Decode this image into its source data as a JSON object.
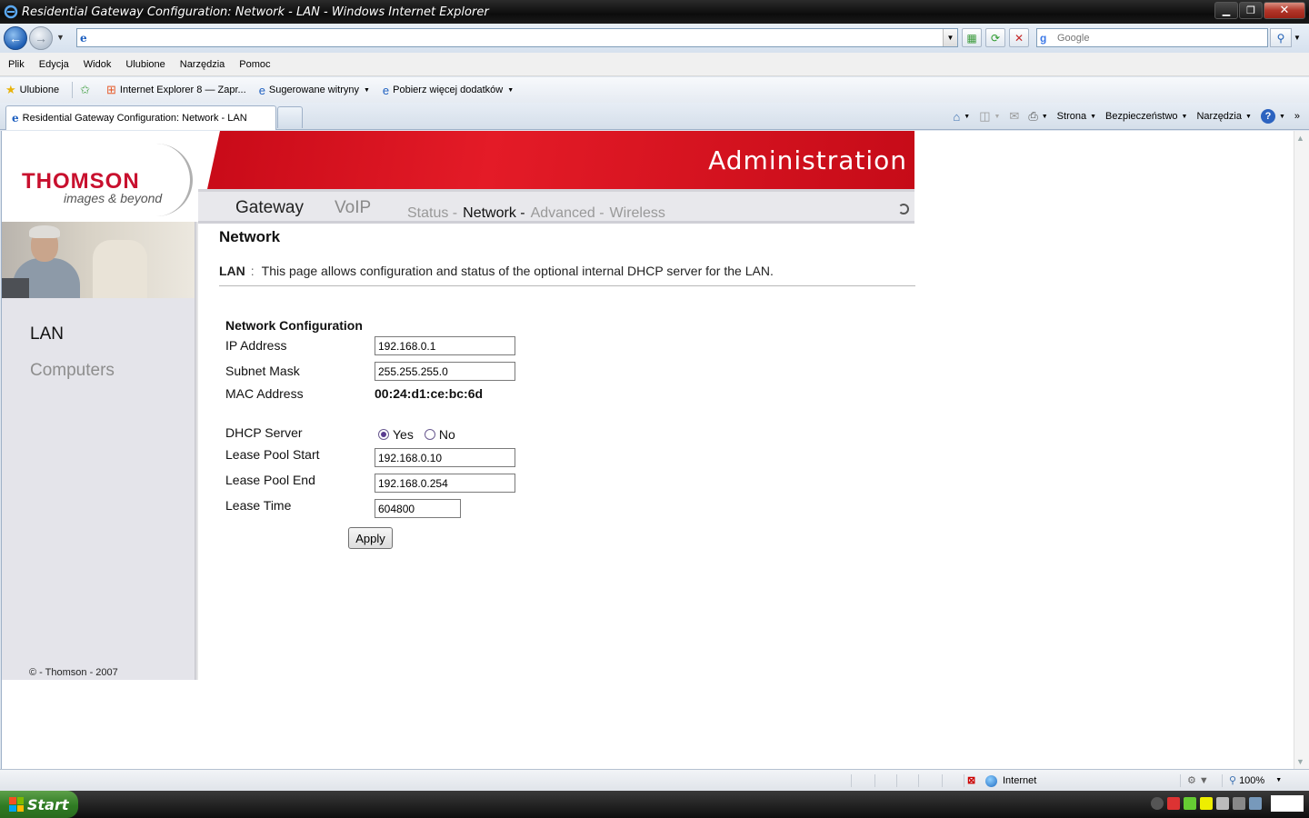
{
  "window": {
    "title": "Residential Gateway Configuration: Network - LAN - Windows Internet Explorer",
    "min_icon": "minimize-icon",
    "max_icon": "restore-icon",
    "close_icon": "close-icon"
  },
  "addressbar": {
    "url": "",
    "search_placeholder": "Google"
  },
  "menubar": {
    "items": [
      "Plik",
      "Edycja",
      "Widok",
      "Ulubione",
      "Narzędzia",
      "Pomoc"
    ]
  },
  "favorites": {
    "label": "Ulubione",
    "items": [
      "Internet Explorer 8 — Zapr...",
      "Sugerowane witryny",
      "Pobierz więcej dodatków"
    ]
  },
  "tabs": {
    "active": "Residential Gateway Configuration: Network - LAN"
  },
  "commandbar": {
    "items": [
      "Strona",
      "Bezpieczeństwo",
      "Narzędzia"
    ]
  },
  "router": {
    "brand": "THOMSON",
    "tagline": "images & beyond",
    "header_title": "Administration",
    "top_nav": [
      "Gateway",
      "VoIP"
    ],
    "sub_nav": {
      "status": "Status -",
      "network": "Network -",
      "advanced": "Advanced -",
      "wireless": "Wireless"
    },
    "sidebar": {
      "items": [
        "LAN",
        "Computers"
      ],
      "copyright": "© - Thomson - 2007"
    },
    "page": {
      "title": "Network",
      "section": "LAN",
      "colon": ":",
      "description": "This page allows configuration and status of the optional internal DHCP server for the LAN.",
      "form_heading": "Network Configuration",
      "labels": {
        "ip": "IP Address",
        "subnet": "Subnet Mask",
        "mac": "MAC Address",
        "dhcp": "DHCP Server",
        "pool_start": "Lease Pool Start",
        "pool_end": "Lease Pool End",
        "lease_time": "Lease Time"
      },
      "values": {
        "ip": "192.168.0.1",
        "subnet": "255.255.255.0",
        "mac": "00:24:d1:ce:bc:6d",
        "dhcp_yes": "Yes",
        "dhcp_no": "No",
        "dhcp_selected": "Yes",
        "pool_start": "192.168.0.10",
        "pool_end": "192.168.0.254",
        "lease_time": "604800"
      },
      "apply": "Apply"
    }
  },
  "statusbar": {
    "zone": "Internet",
    "zoom": "100%"
  },
  "taskbar": {
    "start": "Start"
  }
}
